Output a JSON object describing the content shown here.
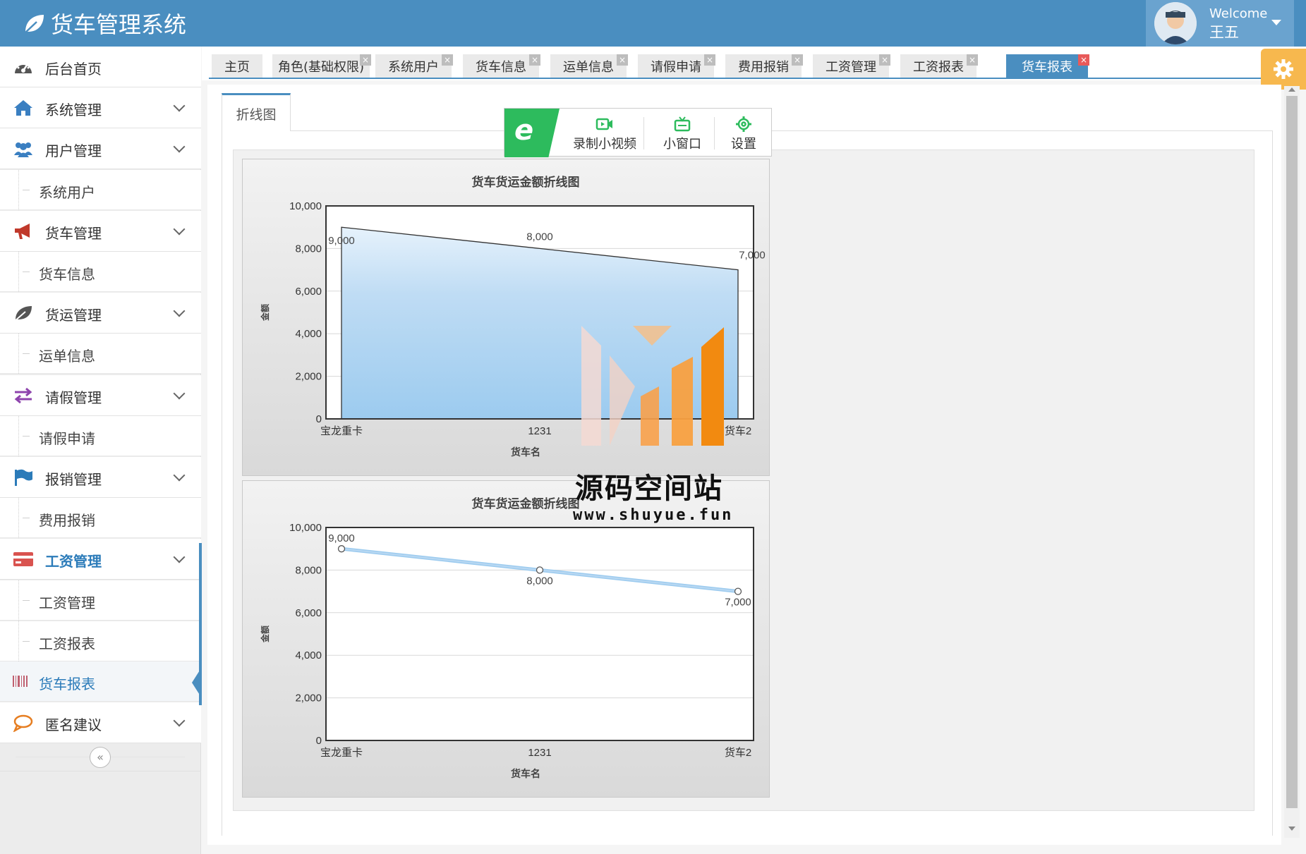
{
  "app": {
    "title": "货车管理系统"
  },
  "user": {
    "welcome": "Welcome",
    "name": "王五"
  },
  "sidebar": {
    "items": [
      {
        "label": "后台首页",
        "icon": "dashboard-icon",
        "color": "#555555"
      },
      {
        "label": "系统管理",
        "icon": "home-icon",
        "color": "#3a7fc1"
      },
      {
        "label": "用户管理",
        "icon": "users-icon",
        "color": "#3a7fc1"
      },
      {
        "label": "系统用户"
      },
      {
        "label": "货车管理",
        "icon": "megaphone-icon",
        "color": "#c0392b"
      },
      {
        "label": "货车信息"
      },
      {
        "label": "货运管理",
        "icon": "leaf-icon",
        "color": "#555555"
      },
      {
        "label": "运单信息"
      },
      {
        "label": "请假管理",
        "icon": "exchange-icon",
        "color": "#8e44ad"
      },
      {
        "label": "请假申请"
      },
      {
        "label": "报销管理",
        "icon": "flag-icon",
        "color": "#2b7bb9"
      },
      {
        "label": "费用报销"
      },
      {
        "label": "工资管理",
        "icon": "credit-card-icon",
        "color": "#d9534f"
      },
      {
        "label": "工资管理"
      },
      {
        "label": "工资报表"
      },
      {
        "label": "货车报表",
        "icon": "barcode-icon",
        "color": "#c06070"
      },
      {
        "label": "匿名建议",
        "icon": "comment-icon",
        "color": "#e67e22"
      }
    ],
    "collapse_symbol": "«"
  },
  "tabs": [
    {
      "label": "主页",
      "closable": false
    },
    {
      "label": "角色(基础权限)",
      "closable": true
    },
    {
      "label": "系统用户",
      "closable": true
    },
    {
      "label": "货车信息",
      "closable": true
    },
    {
      "label": "运单信息",
      "closable": true
    },
    {
      "label": "请假申请",
      "closable": true
    },
    {
      "label": "费用报销",
      "closable": true
    },
    {
      "label": "工资管理",
      "closable": true
    },
    {
      "label": "工资报表",
      "closable": true
    },
    {
      "label": "货车报表",
      "closable": true,
      "active": true
    }
  ],
  "tab_close_symbol": "×",
  "inner_tab": {
    "label": "折线图"
  },
  "toolbar": {
    "logo_letter": "e",
    "record_label": "录制小视频",
    "window_label": "小窗口",
    "settings_label": "设置"
  },
  "watermark": {
    "title": "源码空间站",
    "url": "www.shuyue.fun"
  },
  "colors": {
    "header": "#4a8ec0",
    "accent": "#4a8ec0",
    "toolbar_green": "#2dbb5d",
    "gear": "#f7b84e"
  },
  "chart_data": [
    {
      "type": "area",
      "title": "货车货运金额折线图",
      "xlabel": "货车名",
      "ylabel": "金额",
      "categories": [
        "宝龙重卡",
        "1231",
        "货车2"
      ],
      "series": [
        {
          "values": [
            9000,
            8000,
            7000
          ]
        }
      ],
      "data_labels": [
        "9,000",
        "8,000",
        "7,000"
      ],
      "ylim": [
        0,
        10000
      ],
      "yticks": [
        "0",
        "2,000",
        "4,000",
        "6,000",
        "8,000",
        "10,000"
      ],
      "grid": true
    },
    {
      "type": "line",
      "title": "货车货运金额折线图",
      "xlabel": "货车名",
      "ylabel": "金额",
      "categories": [
        "宝龙重卡",
        "1231",
        "货车2"
      ],
      "series": [
        {
          "values": [
            9000,
            8000,
            7000
          ]
        }
      ],
      "data_labels": [
        "9,000",
        "8,000",
        "7,000"
      ],
      "ylim": [
        0,
        10000
      ],
      "yticks": [
        "0",
        "2,000",
        "4,000",
        "6,000",
        "8,000",
        "10,000"
      ],
      "grid": true
    }
  ]
}
